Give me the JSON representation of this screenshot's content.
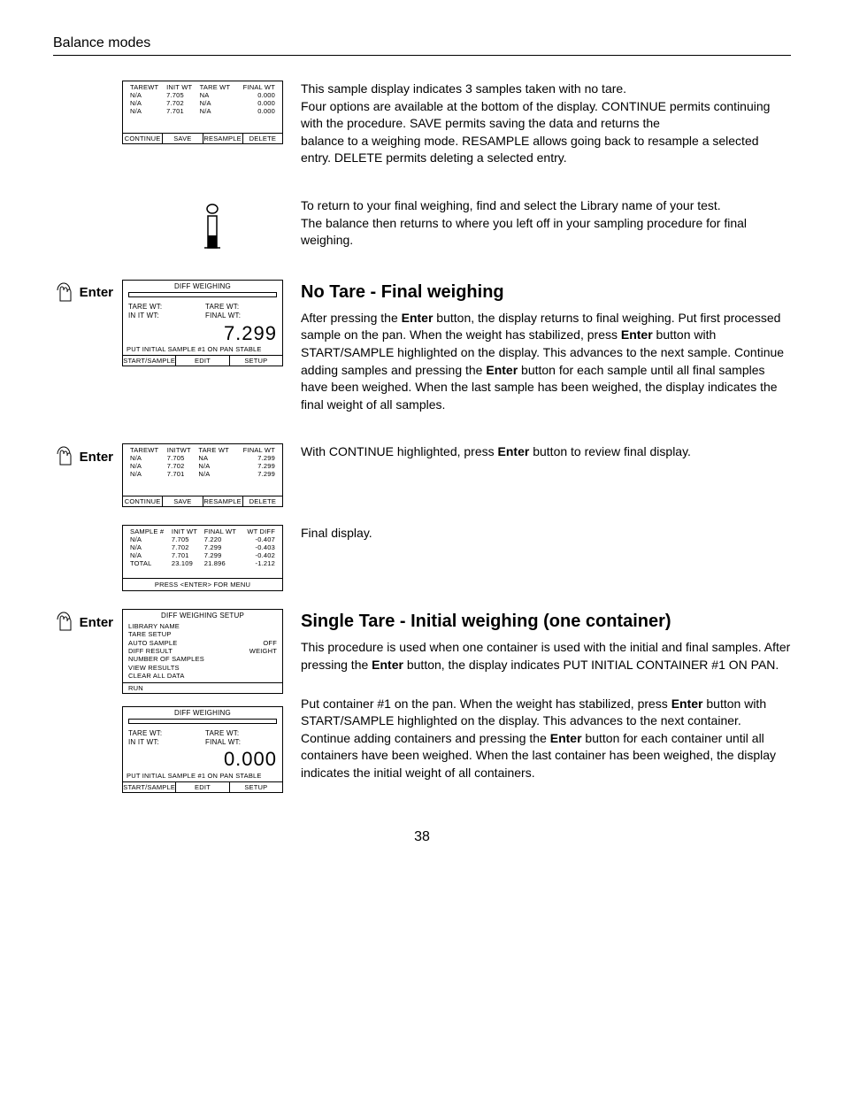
{
  "header": "Balance modes",
  "page_number": "38",
  "labels": {
    "enter": "Enter"
  },
  "screens": {
    "s1": {
      "headers": [
        "TAREWT",
        "INIT WT",
        "TARE WT",
        "FINAL WT"
      ],
      "rows": [
        [
          "N/A",
          "7.705",
          "NA",
          "0.000"
        ],
        [
          "N/A",
          "7.702",
          "N/A",
          "0.000"
        ],
        [
          "N/A",
          "7.701",
          "N/A",
          "0.000"
        ]
      ],
      "softkeys": [
        "CONTINUE",
        "SAVE",
        "RESAMPLE",
        "DELETE"
      ]
    },
    "s2": {
      "title": "DIFF WEIGHING",
      "left1": "TARE WT:",
      "left2": "IN IT WT:",
      "right1": "TARE WT:",
      "right2": "FINAL WT:",
      "big": "7.299",
      "msg": "PUT INITIAL SAMPLE #1 ON PAN STABLE",
      "softkeys": [
        "START/SAMPLE",
        "EDIT",
        "SETUP"
      ]
    },
    "s3": {
      "headers": [
        "TAREWT",
        "INITWT",
        "TARE WT",
        "FINAL WT"
      ],
      "rows": [
        [
          "N/A",
          "7.705",
          "NA",
          "7.299"
        ],
        [
          "N/A",
          "7.702",
          "N/A",
          "7.299"
        ],
        [
          "N/A",
          "7.701",
          "N/A",
          "7.299"
        ]
      ],
      "softkeys": [
        "CONTINUE",
        "SAVE",
        "RESAMPLE",
        "DELETE"
      ]
    },
    "s4": {
      "headers": [
        "SAMPLE #",
        "INIT WT",
        "FINAL WT",
        "WT DIFF"
      ],
      "rows": [
        [
          "N/A",
          "7.705",
          "7.220",
          "-0.407"
        ],
        [
          "N/A",
          "7.702",
          "7.299",
          "-0.403"
        ],
        [
          "N/A",
          "7.701",
          "7.299",
          "-0.402"
        ],
        [
          "TOTAL",
          "23.109",
          "21.896",
          "-1.212"
        ]
      ],
      "footer": "PRESS <ENTER> FOR MENU"
    },
    "s5": {
      "title": "DIFF WEIGHING SETUP",
      "lines": [
        [
          "LIBRARY NAME",
          ""
        ],
        [
          "TARE SETUP",
          ""
        ],
        [
          "AUTO SAMPLE",
          "OFF"
        ],
        [
          "DIFF RESULT",
          "WEIGHT"
        ],
        [
          "NUMBER OF SAMPLES",
          ""
        ],
        [
          "VIEW RESULTS",
          ""
        ],
        [
          "CLEAR ALL DATA",
          ""
        ]
      ],
      "run": "RUN"
    },
    "s6": {
      "title": "DIFF WEIGHING",
      "left1": "TARE WT:",
      "left2": "IN IT WT:",
      "right1": "TARE WT:",
      "right2": "FINAL WT:",
      "big": "0.000",
      "msg": "PUT INITIAL SAMPLE #1 ON PAN STABLE",
      "softkeys": [
        "START/SAMPLE",
        "EDIT",
        "SETUP"
      ]
    }
  },
  "text": {
    "p1a": "This sample display indicates 3 samples taken with no tare.",
    "p1b": "Four options are available at the bottom of the display. CONTINUE permits continuing with the procedure. SAVE permits saving the data and returns the",
    "p1c": "balance to a weighing mode.  RESAMPLE allows going back to resample a selected entry.  DELETE permits deleting a selected entry.",
    "p2a": "To return to your final weighing, find and select the Library name of your test.",
    "p2b": "The balance then returns to where you left off in your sampling procedure for final weighing.",
    "h1": "No Tare - Final weighing",
    "p3a_pre": "After pressing the ",
    "p3a_mid1": " button, the display returns to final weighing. Put first processed sample on the pan.  When the weight has stabilized, press ",
    "p3a_mid2": " button with START/SAMPLE highlighted on the display.  This advances to the next sample.  Continue adding samples and pressing the ",
    "p3a_end": " button for each sample until all final samples have been weighed.  When the last sample has been weighed, the display indicates the final weight of all samples.",
    "p4_pre": "With CONTINUE highlighted, press ",
    "p4_post": " button to review final display.",
    "p5": "Final display.",
    "h2": "Single Tare - Initial weighing (one container)",
    "p6_pre": "This procedure is used when one container is used with the initial and final samples. After pressing the ",
    "p6_post": " button, the display indicates PUT INITIAL CONTAINER  #1 ON PAN.",
    "p7_pre": "Put container #1 on the pan.  When the weight has stabilized, press ",
    "p7_mid": " button with START/SAMPLE highlighted on the display. This advances to the next container. Continue adding containers and pressing the ",
    "p7_end": " button for each container until all containers have been weighed. When the last container has been weighed, the display indicates the initial weight of all containers.",
    "enter_word": "Enter"
  }
}
